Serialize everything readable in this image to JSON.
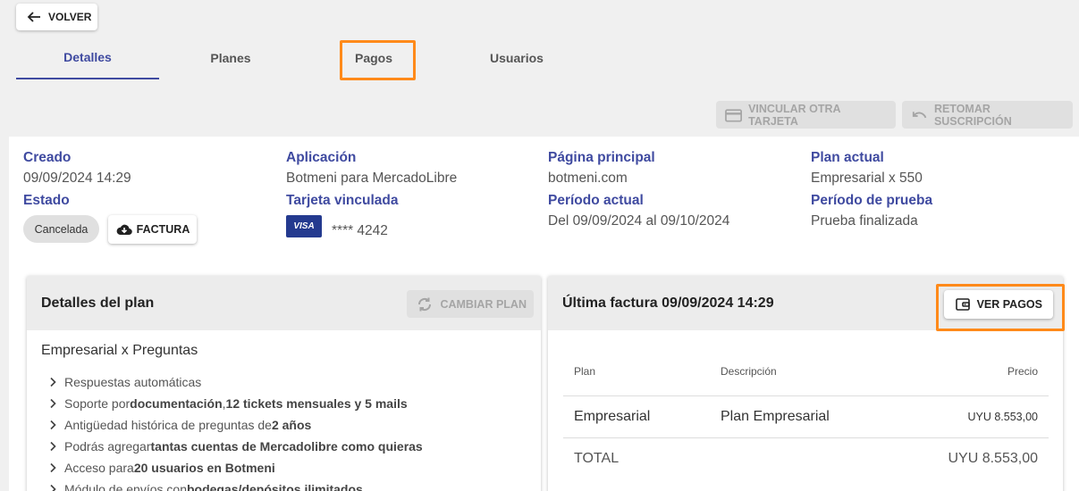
{
  "nav": {
    "back_label": "VOLVER"
  },
  "tabs": [
    {
      "label": "Detalles",
      "active": true
    },
    {
      "label": "Planes"
    },
    {
      "label": "Pagos"
    },
    {
      "label": "Usuarios"
    }
  ],
  "actions": {
    "link_card_label": "VINCULAR OTRA TARJETA",
    "resume_label": "RETOMAR SUSCRIPCIÓN"
  },
  "info": {
    "created_label": "Creado",
    "created_value": "09/09/2024 14:29",
    "status_label": "Estado",
    "status_value": "Cancelada",
    "invoice_button": "FACTURA",
    "app_label": "Aplicación",
    "app_value": "Botmeni para MercadoLibre",
    "card_label": "Tarjeta vinculada",
    "card_brand": "VISA",
    "card_number": "**** 4242",
    "home_label": "Página principal",
    "home_value": "botmeni.com",
    "period_label": "Período actual",
    "period_value": "Del 09/09/2024 al 09/10/2024",
    "plan_label": "Plan actual",
    "plan_value": "Empresarial x 550",
    "trial_label": "Período de prueba",
    "trial_value": "Prueba finalizada"
  },
  "plan_card": {
    "title": "Detalles del plan",
    "change_label": "CAMBIAR PLAN",
    "plan_name": "Empresarial x Preguntas",
    "features": [
      {
        "pre": "Respuestas automáticas"
      },
      {
        "pre": "Soporte por ",
        "bold": "documentación",
        "mid": ", ",
        "bold2": "12 tickets mensuales y 5 mails"
      },
      {
        "pre": "Antigüedad histórica de preguntas de ",
        "bold": "2 años"
      },
      {
        "pre": "Podrás agregar ",
        "bold": "tantas cuentas de Mercadolibre como quieras"
      },
      {
        "pre": "Acceso para ",
        "bold": "20 usuarios en Botmeni"
      },
      {
        "pre": "Módulo de envíos con ",
        "bold": "bodegas/depósitos ilimitados"
      }
    ]
  },
  "invoice_card": {
    "title": "Última factura 09/09/2024 14:29",
    "view_payments_label": "VER PAGOS",
    "headers": {
      "plan": "Plan",
      "description": "Descripción",
      "price": "Precio"
    },
    "rows": [
      {
        "plan": "Empresarial",
        "description": "Plan Empresarial",
        "price": "UYU 8.553,00"
      }
    ],
    "total_label": "TOTAL",
    "total_value": "UYU 8.553,00"
  },
  "colors": {
    "accent": "#3f4aa0",
    "highlight": "#ff8a1a",
    "disabled_text": "#a5a5a5"
  }
}
